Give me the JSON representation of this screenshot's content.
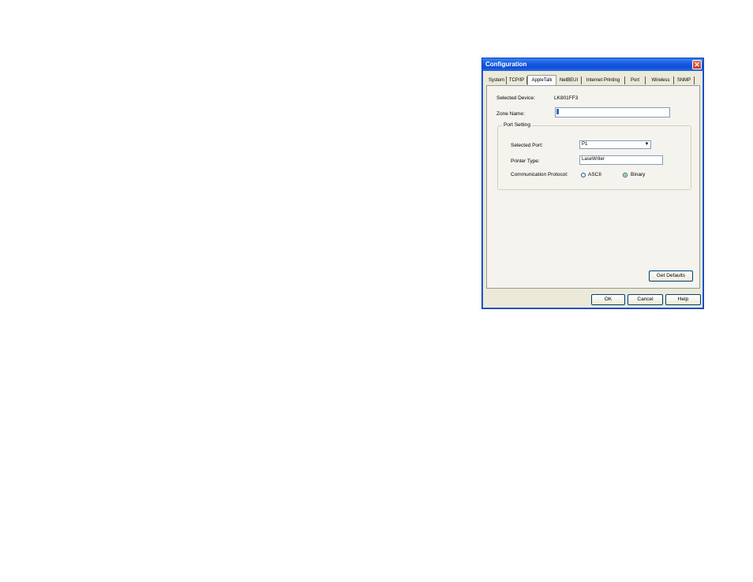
{
  "window": {
    "title": "Configuration",
    "close_glyph": "✕"
  },
  "tabs": [
    {
      "label": "System"
    },
    {
      "label": "TCP/IP"
    },
    {
      "label": "AppleTalk"
    },
    {
      "label": "NetBEUI"
    },
    {
      "label": "Internet Printing"
    },
    {
      "label": "Port"
    },
    {
      "label": "Wireless"
    },
    {
      "label": "SNMP"
    }
  ],
  "active_tab": "AppleTalk",
  "form": {
    "selected_device_label": "Selected Device:",
    "selected_device_value": "LK801FF3",
    "zone_name_label": "Zone Name:",
    "zone_name_value": ""
  },
  "port_setting": {
    "title": "Port Setting",
    "selected_port_label": "Selected Port:",
    "selected_port_value": "P1",
    "printer_type_label": "Printer Type:",
    "printer_type_value": "LaseWriter",
    "protocol_label": "Communication Protocol:",
    "protocol_options": [
      "ASCII",
      "Binary"
    ],
    "protocol_selected": "Binary"
  },
  "buttons": {
    "get_defaults": "Get Defaults",
    "ok": "OK",
    "cancel": "Cancel",
    "help": "Help"
  },
  "colors": {
    "title_bar": "#0f4dd6",
    "dialog_bg": "#ece9d8",
    "close_button": "#c8331b"
  }
}
